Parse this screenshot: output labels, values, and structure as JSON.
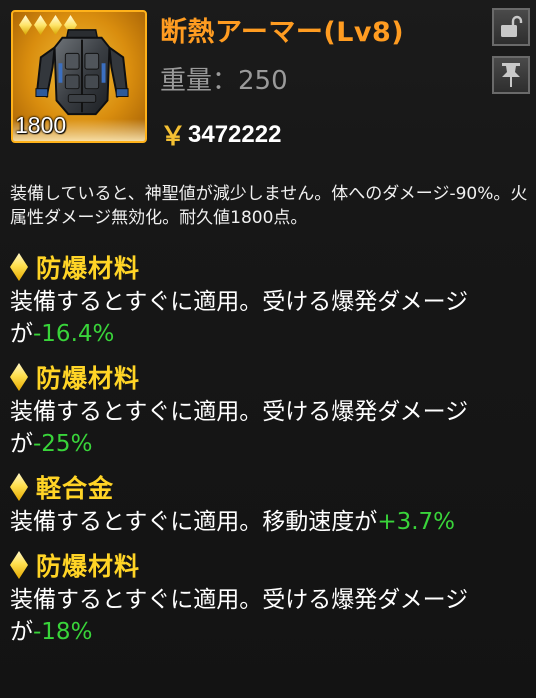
{
  "item": {
    "name": "断熱アーマー(Lv8)",
    "weight_label": "重量：",
    "weight_value": "250",
    "currency_symbol": "￥",
    "price": "3472222",
    "count": "1800",
    "icon": "body-armor-vest",
    "rarity_pips": 4,
    "description": "装備していると、神聖値が減少しません。体へのダメージ-90%。火属性ダメージ無効化。耐久値1800点。"
  },
  "buttons": {
    "lock_icon": "lock-open-icon",
    "pin_icon": "pin-icon"
  },
  "modifiers": [
    {
      "name": "防爆材料",
      "text_prefix": "装備するとすぐに適用。受ける爆発ダメージが",
      "value": "-16.4%"
    },
    {
      "name": "防爆材料",
      "text_prefix": "装備するとすぐに適用。受ける爆発ダメージが",
      "value": "-25%"
    },
    {
      "name": "軽合金",
      "text_prefix": "装備するとすぐに適用。移動速度が",
      "value": "+3.7%"
    },
    {
      "name": "防爆材料",
      "text_prefix": "装備するとすぐに適用。受ける爆発ダメージが",
      "value": "-18%"
    }
  ],
  "colors": {
    "title": "#ff9c21",
    "modifier_name": "#ffd426",
    "positive_value": "#39d43a",
    "rarity_frame": "#ffb21a"
  }
}
